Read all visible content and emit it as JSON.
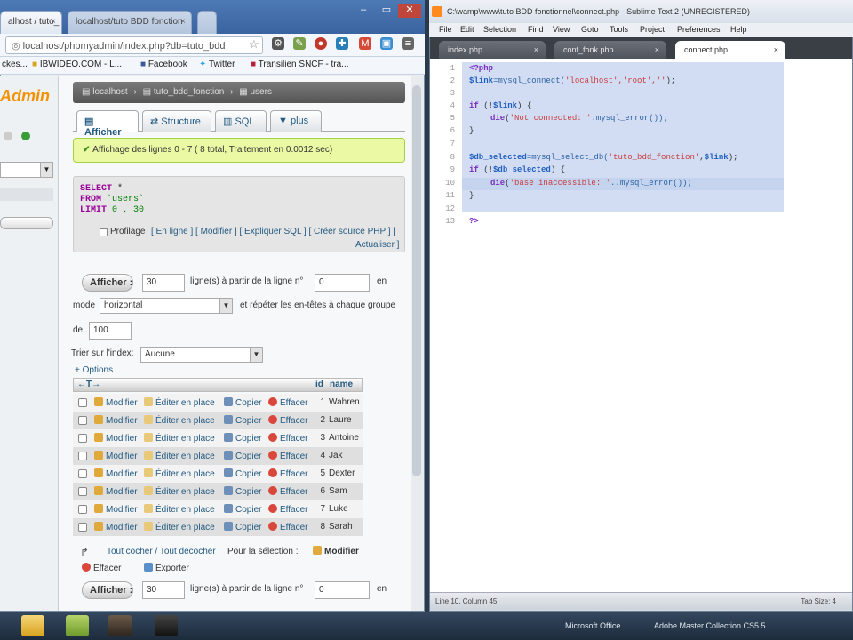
{
  "chrome": {
    "tabs": [
      {
        "label": "alhost / tuto_"
      },
      {
        "label": "localhost/tuto BDD fonction"
      }
    ],
    "address": "localhost/phpmyadmin/index.php?db=tuto_bdd",
    "bookmarks": [
      "ckes...",
      "IBWIDEO.COM - L...",
      "Facebook",
      "Twitter",
      "Transilien SNCF - tra..."
    ]
  },
  "pma": {
    "logo": "Admin",
    "breadcrumb": [
      "localhost",
      "tuto_bdd_fonction",
      "users"
    ],
    "tabs": [
      "Afficher",
      "Structure",
      "SQL",
      "plus"
    ],
    "success_msg": "Affichage des lignes 0 - 7 ( 8 total, Traitement en 0.0012 sec)",
    "sql": {
      "select_kw": "SELECT",
      "select_rest": " *",
      "from_kw": "FROM",
      "from_table": " `users`",
      "limit_kw": "LIMIT",
      "limit_rest": " 0 , 30"
    },
    "profiling_label": "Profilage",
    "sql_links": "[ En ligne ] [ Modifier ] [ Expliquer SQL ] [ Créer source PHP ] [",
    "refresh_link": "Actualiser ]",
    "show_button": "Afficher :",
    "rows_value": "30",
    "rows_label": "ligne(s) à partir de la ligne n°",
    "start_value": "0",
    "en_label": "en",
    "mode_label": "mode",
    "mode_value": "horizontal",
    "repeat_label": "et répéter les en-têtes à chaque groupe",
    "de_label": "de",
    "repeat_value": "100",
    "sort_label": "Trier sur l'index:",
    "sort_value": "Aucune",
    "options_link": "+ Options",
    "table_head": {
      "arrows": "←T→",
      "id": "id",
      "name": "name"
    },
    "row_actions": {
      "edit": "Modifier",
      "inline": "Éditer en place",
      "copy": "Copier",
      "delete": "Effacer"
    },
    "rows": [
      {
        "id": "1",
        "name": "Wahren"
      },
      {
        "id": "2",
        "name": "Laure"
      },
      {
        "id": "3",
        "name": "Antoine"
      },
      {
        "id": "4",
        "name": "Jak"
      },
      {
        "id": "5",
        "name": "Dexter"
      },
      {
        "id": "6",
        "name": "Sam"
      },
      {
        "id": "7",
        "name": "Luke"
      },
      {
        "id": "8",
        "name": "Sarah"
      }
    ],
    "check_all": "Tout cocher / Tout décocher",
    "selection_label": "Pour la sélection :",
    "bulk_edit": "Modifier",
    "bulk_delete": "Effacer",
    "bulk_export": "Exporter",
    "show_button2": "Afficher :",
    "rows_value2": "30",
    "rows_label2": "ligne(s) à partir de la ligne n°",
    "start_value2": "0",
    "en_label2": "en"
  },
  "sublime": {
    "title": "C:\\wamp\\www\\tuto BDD fonctionnel\\connect.php - Sublime Text 2 (UNREGISTERED)",
    "menu": [
      "File",
      "Edit",
      "Selection",
      "Find",
      "View",
      "Goto",
      "Tools",
      "Project",
      "Preferences",
      "Help"
    ],
    "tabs": [
      "index.php",
      "conf_fonk.php",
      "connect.php"
    ],
    "line_numbers": [
      "1",
      "2",
      "3",
      "4",
      "5",
      "6",
      "7",
      "8",
      "9",
      "10",
      "11",
      "12",
      "13"
    ],
    "code": {
      "l1": "<?php",
      "l2a": "$link",
      "l2b": "=mysql_connect(",
      "l2c": "'localhost','root',''",
      "l2d": ");",
      "l4a": "if",
      "l4b": " (!",
      "l4c": "$link",
      "l4d": ") {",
      "l5a": "die",
      "l5b": "(",
      "l5c": "'Not connected: '",
      "l5d": ".mysql_error());",
      "l6": "}",
      "l8a": "$db_selected",
      "l8b": "=mysql_select_db(",
      "l8c": "'tuto_bdd_fonction'",
      "l8d": ",",
      "l8e": "$link",
      "l8f": ");",
      "l9a": "if",
      "l9b": " (!",
      "l9c": "$db_selected",
      "l9d": ") {",
      "l10a": "die",
      "l10b": "(",
      "l10c": "'base inaccessible: '",
      "l10d": "..mysql_error());",
      "l11": "}",
      "l13": "?>"
    },
    "status_left": "Line 10, Column 45",
    "status_right": "Tab Size: 4"
  },
  "taskbar": {
    "labels": [
      "Microsoft Office",
      "Adobe Master Collection CS5.5"
    ]
  },
  "colors": {
    "pma_orange": "#f39200",
    "success_bg": "#ebf8a4",
    "link_blue": "#235a81"
  }
}
